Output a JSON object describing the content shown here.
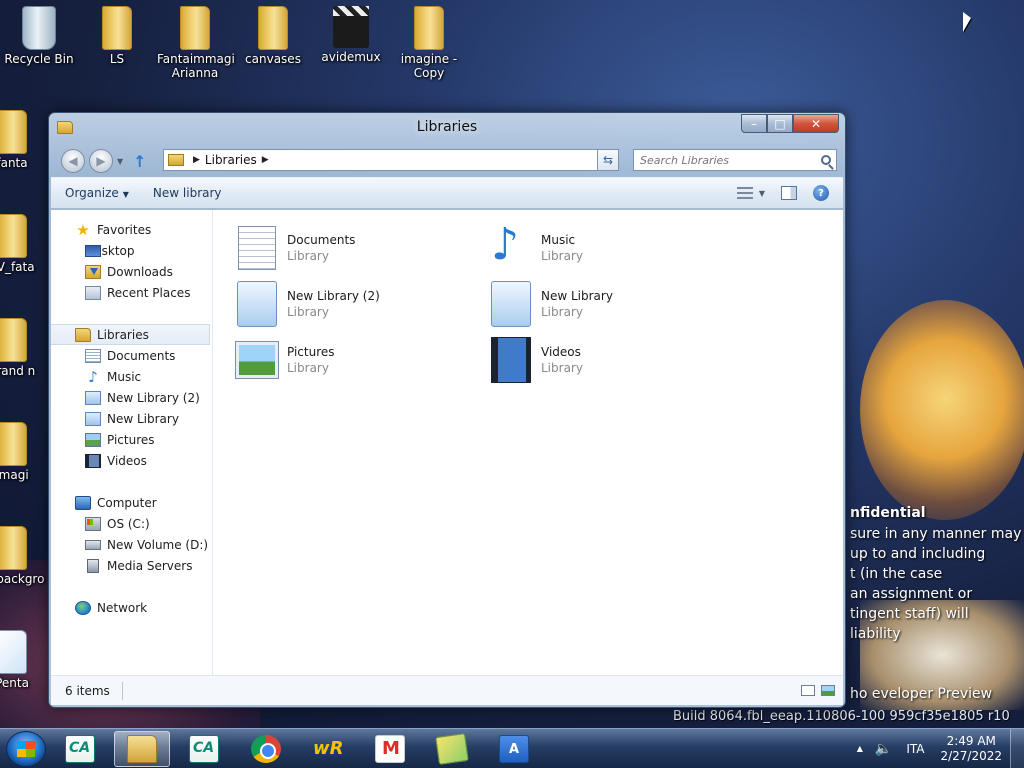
{
  "desktop": {
    "icons": [
      {
        "label": "Recycle Bin"
      },
      {
        "label": "LS"
      },
      {
        "label": "Fantaimmagi Arianna"
      },
      {
        "label": "canvases"
      },
      {
        "label": "avidemux"
      },
      {
        "label": "imagine - Copy"
      }
    ],
    "left_icons": [
      {
        "label": "fanta"
      },
      {
        "label": "TV_fata"
      },
      {
        "label": "brand n"
      },
      {
        "label": "imagi"
      },
      {
        "label": "Ls backgro"
      },
      {
        "label": "Penta"
      }
    ],
    "watermark": {
      "line1": "nfidential",
      "line2": "sure in any manner may",
      "line3": "up to and including",
      "line4": "t (in the case",
      "line5": "an assignment or",
      "line6": "tingent staff) will",
      "line7": "liability",
      "line8": "ho   eveloper Preview",
      "build": "Build 8064.fbl_eeap.110806-100  959cf35e1805  r10"
    }
  },
  "window": {
    "title": "Libraries",
    "caption": {
      "minimize": "–",
      "maximize": "□",
      "close": "✕"
    },
    "address": {
      "crumb": "Libraries"
    },
    "search": {
      "placeholder": "Search Libraries"
    },
    "commands": {
      "organize": "Organize",
      "new_library": "New library"
    },
    "sidebar": {
      "favorites": {
        "label": "Favorites",
        "items": [
          {
            "label": "Desktop",
            "icon": "desktop-icon"
          },
          {
            "label": "Downloads",
            "icon": "downloads-icon"
          },
          {
            "label": "Recent Places",
            "icon": "recent-places-icon"
          }
        ]
      },
      "libraries": {
        "label": "Libraries",
        "items": [
          {
            "label": "Documents",
            "icon": "documents-icon"
          },
          {
            "label": "Music",
            "icon": "music-icon"
          },
          {
            "label": "New Library (2)",
            "icon": "library-icon"
          },
          {
            "label": "New Library",
            "icon": "library-icon"
          },
          {
            "label": "Pictures",
            "icon": "pictures-icon"
          },
          {
            "label": "Videos",
            "icon": "videos-icon"
          }
        ]
      },
      "computer": {
        "label": "Computer",
        "items": [
          {
            "label": "OS (C:)",
            "icon": "os-drive-icon"
          },
          {
            "label": "New Volume (D:)",
            "icon": "drive-icon"
          },
          {
            "label": "Media Servers",
            "icon": "media-server-icon"
          }
        ]
      },
      "network": {
        "label": "Network"
      }
    },
    "content": {
      "tiles": [
        {
          "name": "Documents",
          "type": "Library"
        },
        {
          "name": "Music",
          "type": "Library"
        },
        {
          "name": "New Library (2)",
          "type": "Library"
        },
        {
          "name": "New Library",
          "type": "Library"
        },
        {
          "name": "Pictures",
          "type": "Library"
        },
        {
          "name": "Videos",
          "type": "Library"
        }
      ]
    },
    "status": {
      "items_count": "6 items"
    }
  },
  "taskbar": {
    "apps": [
      {
        "name": "credit-agricole",
        "icon": "credit-agricole-icon"
      },
      {
        "name": "windows-explorer",
        "icon": "folder-icon",
        "active": true
      },
      {
        "name": "credit-agricole-2",
        "icon": "credit-agricole-icon"
      },
      {
        "name": "chrome",
        "icon": "chrome-icon"
      },
      {
        "name": "wordreference",
        "icon": "wordreference-icon",
        "text": "wR"
      },
      {
        "name": "gmail",
        "icon": "gmail-icon"
      },
      {
        "name": "sticky-notes",
        "icon": "sticky-notes-icon"
      },
      {
        "name": "translator",
        "icon": "translate-icon",
        "text": "A"
      }
    ],
    "tray": {
      "language": "ITA",
      "time": "2:49 AM",
      "date": "2/27/2022"
    }
  }
}
